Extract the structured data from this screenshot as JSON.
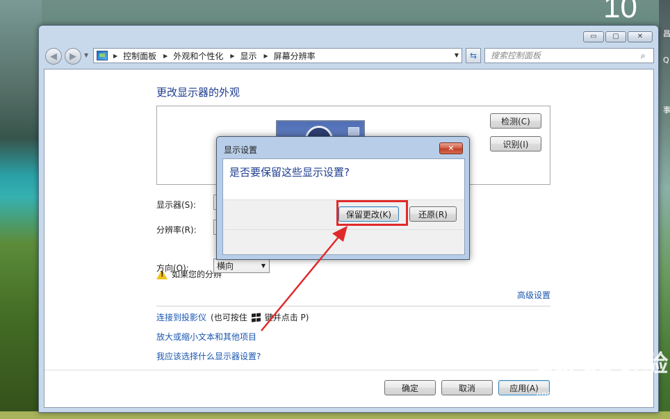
{
  "desktop": {
    "clock_fragment": "10",
    "side_text": [
      "昌",
      "Q",
      "事项"
    ]
  },
  "window": {
    "controls": {
      "minimize": "▭",
      "maximize": "▢",
      "close": "✕"
    },
    "address": {
      "crumbs": [
        "控制面板",
        "外观和个性化",
        "显示",
        "屏幕分辨率"
      ]
    },
    "search": {
      "placeholder": "搜索控制面板"
    },
    "page_title": "更改显示器的外观",
    "buttons": {
      "detect": "检测(C)",
      "identify": "识别(I)",
      "ok": "确定",
      "cancel": "取消",
      "apply": "应用(A)"
    },
    "form": {
      "display_label": "显示器(S):",
      "resolution_label": "分辨率(R):",
      "warning_text": "如果您的分辨",
      "orientation_label": "方向(O):",
      "orientation_value": "横向"
    },
    "links": {
      "advanced": "高级设置",
      "projector": "连接到投影仪",
      "projector_hint_before": "(也可按住",
      "projector_hint_after": "键并点击 P)",
      "text_size": "放大或缩小文本和其他项目",
      "which_settings": "我应该选择什么显示器设置?"
    }
  },
  "dialog": {
    "title": "显示设置",
    "question": "是否要保留这些显示设置?",
    "keep_button": "保留更改(K)",
    "revert_button": "还原(R)"
  },
  "annotation": {
    "color": "#e02a2a"
  },
  "watermark": {
    "brand": "Bai du 经验",
    "sub": "jingyan.baidu.com"
  }
}
